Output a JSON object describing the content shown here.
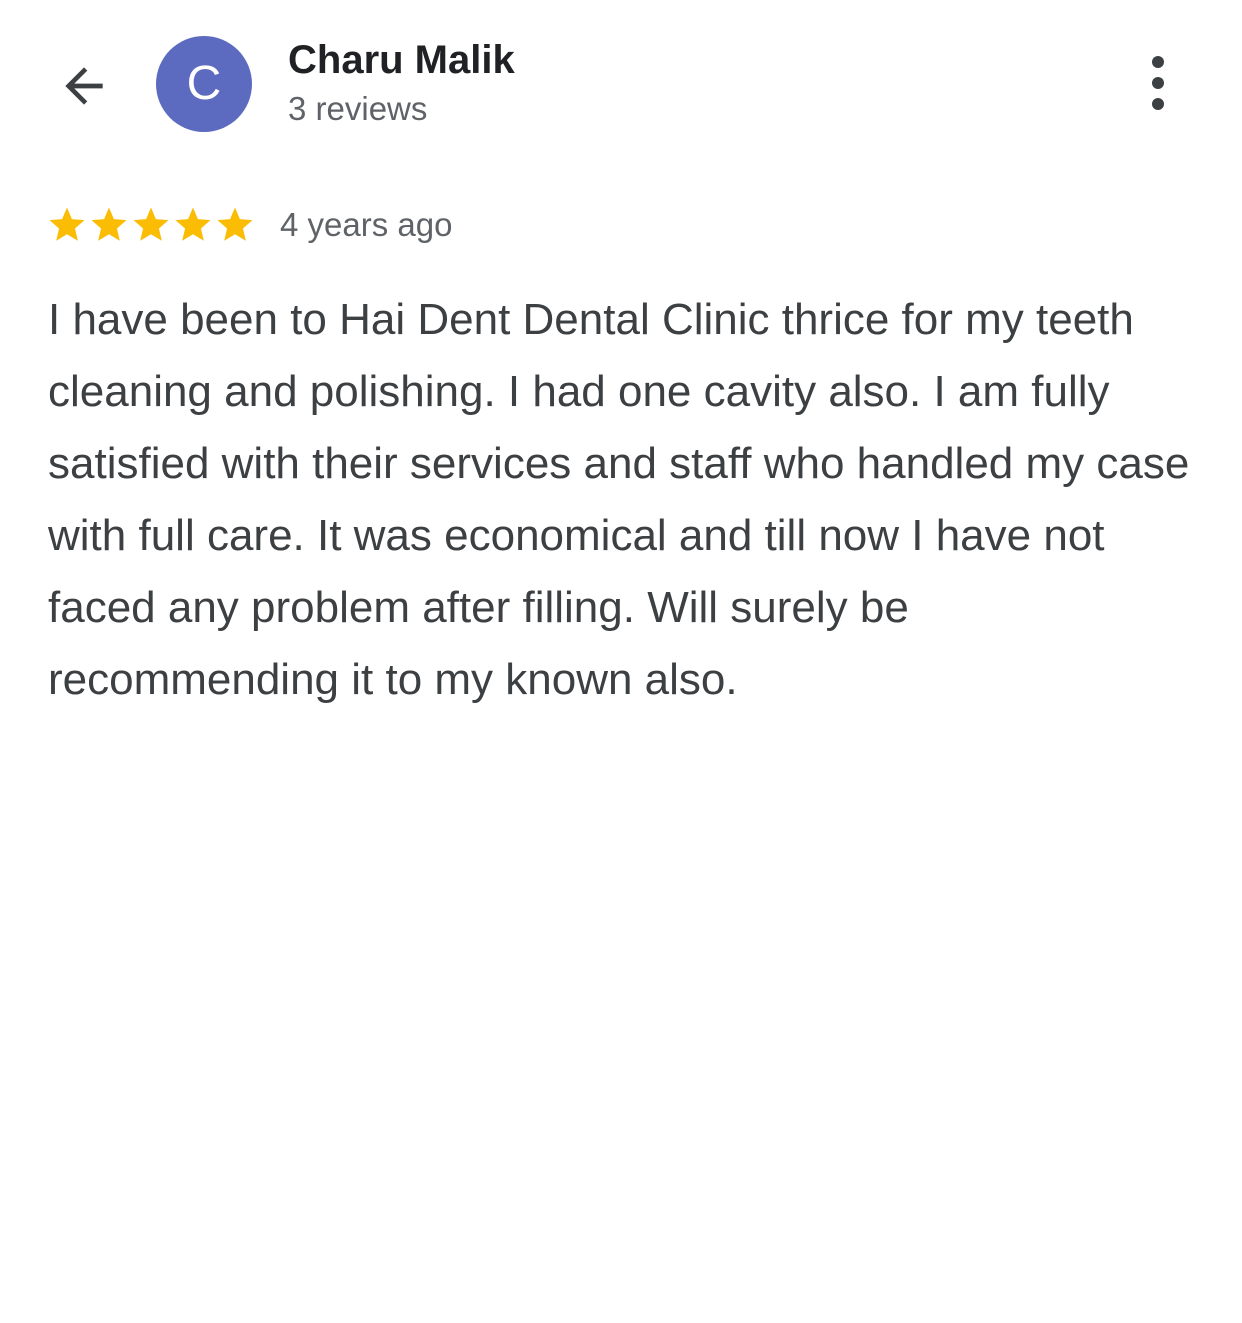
{
  "header": {
    "user_name": "Charu Malik",
    "review_count": "3 reviews",
    "avatar_initial": "C",
    "avatar_color": "#5c6bc0",
    "back_icon": "arrow-back-icon",
    "more_icon": "more-vert-icon"
  },
  "review": {
    "rating": 5,
    "rating_max": 5,
    "star_color": "#fbbc04",
    "date": "4 years ago",
    "text": "I have been to Hai Dent Dental Clinic thrice for my teeth cleaning and polishing. I had one cavity also. I am fully satisfied with their services and staff who handled my case with full care. It was economical and till now I have not faced any problem after filling. Will surely be recommending it to my known also."
  }
}
